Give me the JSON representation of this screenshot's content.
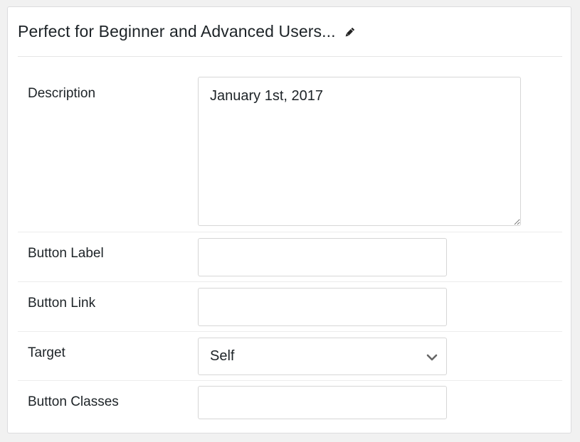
{
  "panel": {
    "title": "Perfect for Beginner and Advanced Users...",
    "edit_icon": "pencil-icon"
  },
  "fields": {
    "description": {
      "label": "Description",
      "value": "January 1st, 2017"
    },
    "button_label": {
      "label": "Button Label",
      "value": ""
    },
    "button_link": {
      "label": "Button Link",
      "value": ""
    },
    "target": {
      "label": "Target",
      "value": "Self",
      "icon": "chevron-down-icon"
    },
    "button_classes": {
      "label": "Button Classes",
      "value": ""
    }
  }
}
